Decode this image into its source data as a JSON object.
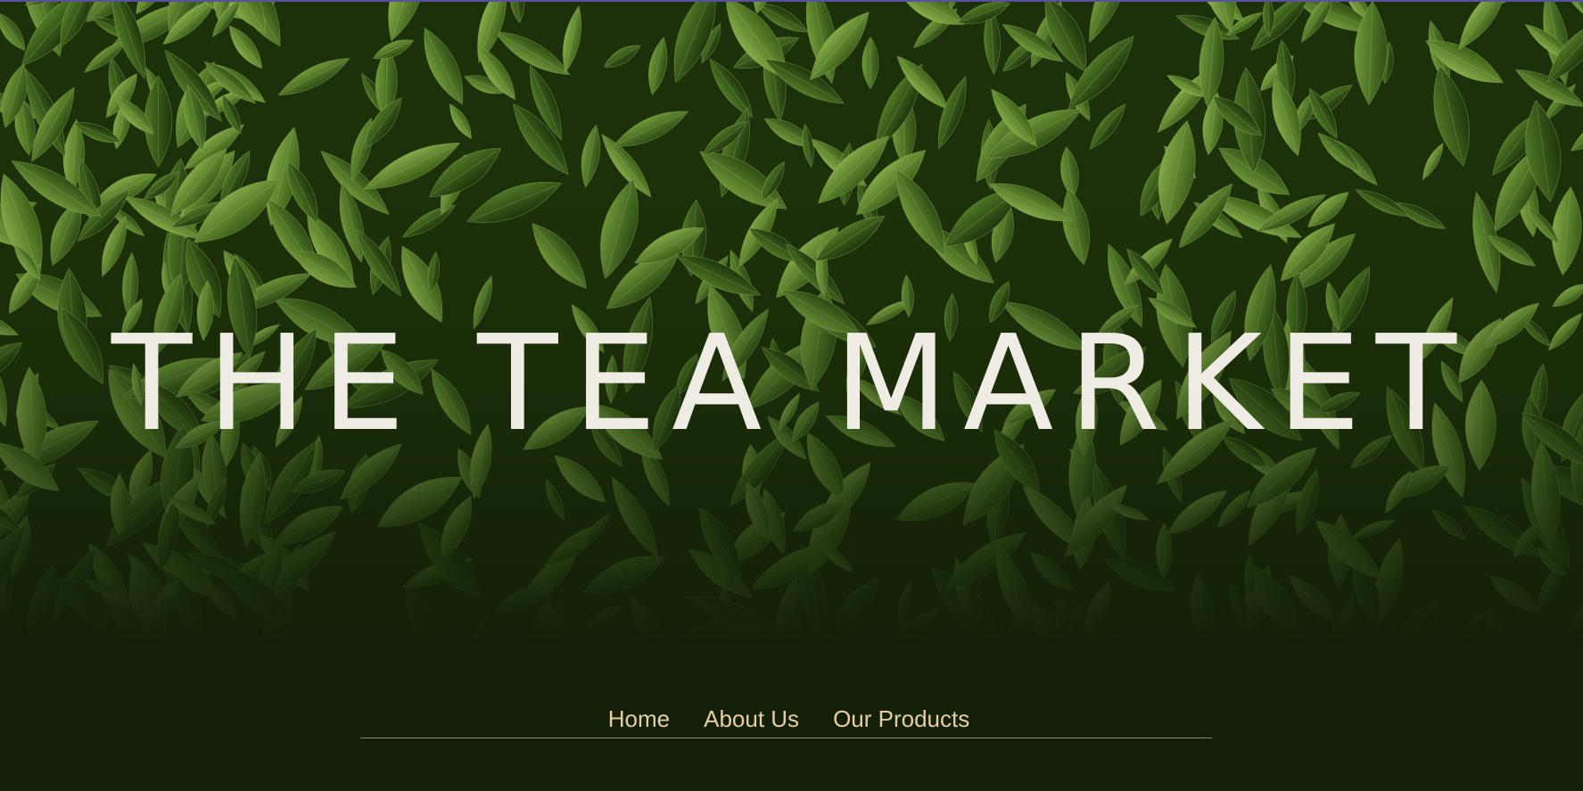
{
  "site": {
    "title": "THE TEA MARKET"
  },
  "nav": {
    "items": [
      {
        "label": "Home"
      },
      {
        "label": "About Us"
      },
      {
        "label": "Our Products"
      }
    ]
  },
  "hero": {
    "image_subject": "tea-leaves",
    "colors": {
      "background": "#132007",
      "title_text": "#efece4",
      "nav_text": "#e6cda3",
      "nav_underline": "#8c8a70",
      "top_accent": "#5a4fa0"
    }
  }
}
